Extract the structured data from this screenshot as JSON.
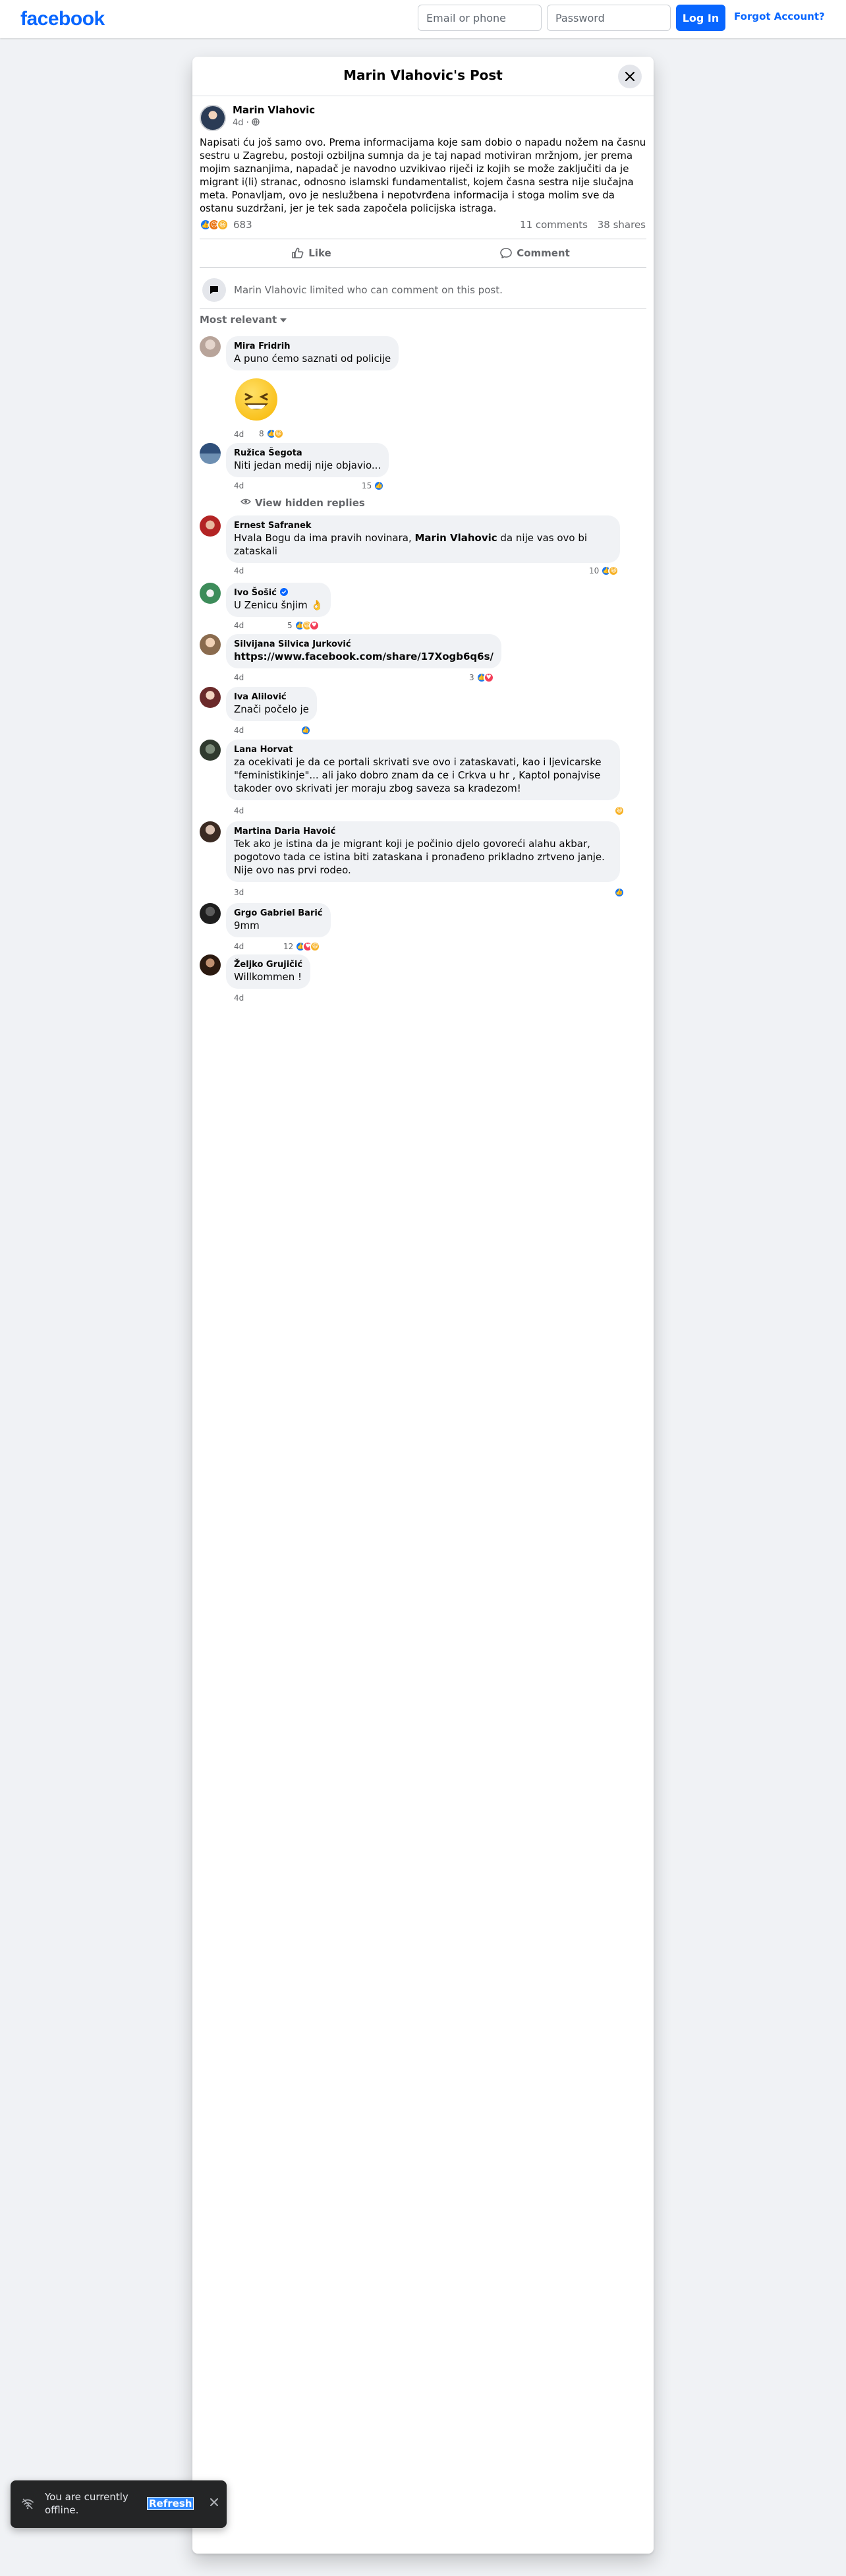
{
  "topbar": {
    "logo": "facebook",
    "email_placeholder": "Email or phone",
    "password_placeholder": "Password",
    "login_label": "Log In",
    "forgot_label": "Forgot Account?"
  },
  "dialog": {
    "title": "Marin Vlahovic's Post",
    "close_icon": "close-icon"
  },
  "post": {
    "author": "Marin Vlahovic",
    "time": "4d ·",
    "audience_icon": "globe-icon",
    "text": "Napisati ću još samo ovo. Prema informacijama koje sam dobio o napadu nožem na časnu sestru u Zagrebu, postoji ozbiljna sumnja da je taj napad motiviran mržnjom, jer prema mojim saznanjima, napadač je navodno uzvikivao riječi iz kojih se može zaključiti da je migrant i(li) stranac, odnosno islamski fundamentalist, kojem časna sestra nije slučajna meta. Ponavljam, ovo je neslužbena i nepotvrđena informacija i stoga molim sve da ostanu suzdržani, jer je tek sada započela policijska istraga.",
    "reaction_count": "683",
    "comments_count": "11 comments",
    "shares_count": "38 shares",
    "like_label": "Like",
    "comment_label": "Comment",
    "limited_text": "Marin Vlahovic limited who can comment on this post.",
    "sort_label": "Most relevant"
  },
  "comments": [
    {
      "name": "Mira Fridrih",
      "text": "A puno ćemo saznati od policije",
      "time": "4d",
      "reactions": "8"
    },
    {
      "name": "Ružica Šegota",
      "text": "Niti jedan medij nije objavio...",
      "time": "4d",
      "reactions": "15"
    },
    {
      "hidden_replies": "View hidden replies"
    },
    {
      "name": "Ernest Safranek",
      "text_pre": "Hvala Bogu da ima pravih novinara, ",
      "text_bold": "Marin Vlahovic",
      "text_post": " da nije vas ovo bi zataskali",
      "time": "4d",
      "reactions": "10"
    },
    {
      "name": "Ivo Šošić",
      "text": "U Zenicu šnjim",
      "emoji": "👌",
      "time": "4d",
      "reactions": "5"
    },
    {
      "name": "Silvijana Silvica Jurković",
      "text": "https://www.facebook.com/share/17Xogb6q6s/",
      "time": "4d",
      "reactions": "3"
    },
    {
      "name": "Iva Alilović",
      "text": "Znači počelo je",
      "time": "4d",
      "reactions": ""
    },
    {
      "name": "Lana Horvat",
      "text": "za ocekivati je da ce portali skrivati sve ovo i zataskavati, kao i ljevicarske \"feministikinje\"... ali jako dobro znam da ce i Crkva u hr , Kaptol ponajvise takoder ovo skrivati jer moraju zbog saveza sa kradezom!",
      "time": "4d",
      "reactions": ""
    },
    {
      "name": "Martina Daria Havoić",
      "text": "Tek ako je istina da je migrant koji je počinio djelo govoreći alahu akbar, pogotovo tada ce istina biti zataskana i pronađeno prikladno zrtveno janje. Nije ovo nas prvi rodeo.",
      "time": "3d",
      "reactions": ""
    },
    {
      "name": "Grgo Gabriel Barić",
      "text": "9mm",
      "time": "4d",
      "reactions": "12"
    },
    {
      "name": "Željko Grujičić",
      "text": "Willkommen !",
      "time": "4d",
      "reactions": ""
    }
  ],
  "toast": {
    "text": "You are currently offline.",
    "refresh_label": "Refresh",
    "wifi_icon": "wifi-off-icon",
    "close_icon": "close-icon"
  },
  "colors": {
    "brand": "#0866ff",
    "like": "#1877f2",
    "love": "#f33e58",
    "haha": "#f7b125"
  }
}
